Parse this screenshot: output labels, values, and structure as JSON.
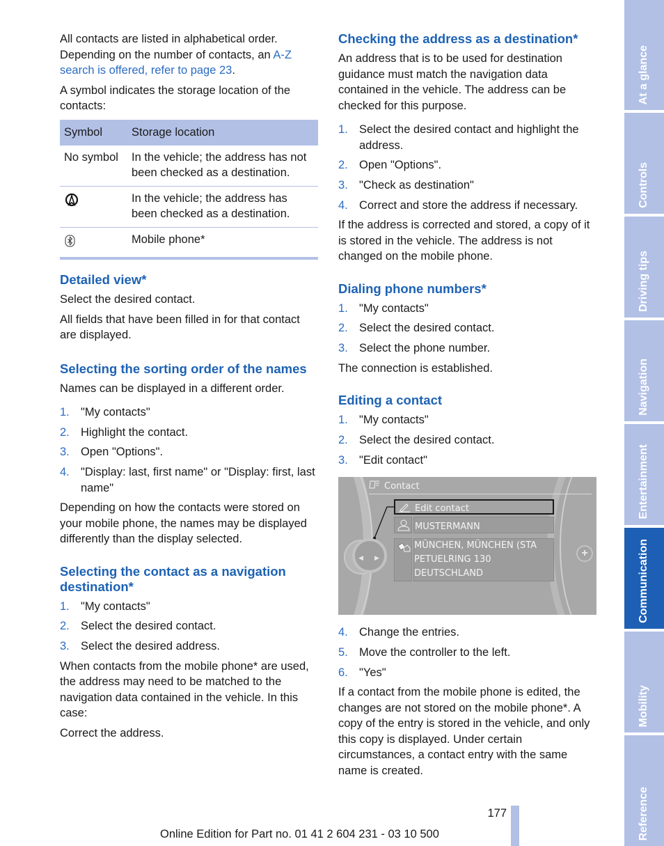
{
  "left": {
    "intro": {
      "text_before_link": "All contacts are listed in alphabetical order. Depending on the number of contacts, an ",
      "link": "A-Z search is offered, refer to page 23",
      "text_after_link": "."
    },
    "symbol_intro": "A symbol indicates the storage location of the contacts:",
    "table": {
      "headers": [
        "Symbol",
        "Storage location"
      ],
      "rows": [
        {
          "symbol": "No symbol",
          "icon": null,
          "location": "In the vehicle; the address has not been checked as a destination."
        },
        {
          "symbol": "",
          "icon": "navigation-checked-icon",
          "location": "In the vehicle; the address has been checked as a destination."
        },
        {
          "symbol": "",
          "icon": "bluetooth-phone-icon",
          "location": "Mobile phone*"
        }
      ]
    },
    "detailed_view": {
      "heading": "Detailed view*",
      "p1": "Select the desired contact.",
      "p2": "All fields that have been filled in for that contact are displayed."
    },
    "sorting": {
      "heading": "Selecting the sorting order of the names",
      "p1": "Names can be displayed in a different order.",
      "steps": [
        {
          "num": "1.",
          "text": "\"My contacts\""
        },
        {
          "num": "2.",
          "text": "Highlight the contact."
        },
        {
          "num": "3.",
          "text": "Open \"Options\"."
        },
        {
          "num": "4.",
          "text": "\"Display: last, first name\" or \"Display: first, last name\""
        }
      ],
      "p2": "Depending on how the contacts were stored on your mobile phone, the names may be displayed differently than the display selected."
    },
    "nav_dest": {
      "heading": "Selecting the contact as a navigation destination*",
      "steps": [
        {
          "num": "1.",
          "text": "\"My contacts\""
        },
        {
          "num": "2.",
          "text": "Select the desired contact."
        },
        {
          "num": "3.",
          "text": "Select the desired address."
        }
      ],
      "p1": "When contacts from the mobile phone* are used, the address may need to be matched to the navigation data contained in the vehicle. In this case:",
      "p2": "Correct the address."
    }
  },
  "right": {
    "checking": {
      "heading": "Checking the address as a destination*",
      "p1": "An address that is to be used for destination guidance must match the navigation data contained in the vehicle. The address can be checked for this purpose.",
      "steps": [
        {
          "num": "1.",
          "text": "Select the desired contact and highlight the address."
        },
        {
          "num": "2.",
          "text": "Open \"Options\"."
        },
        {
          "num": "3.",
          "text": "\"Check as destination\""
        },
        {
          "num": "4.",
          "text": "Correct and store the address if necessary."
        }
      ],
      "p2": "If the address is corrected and stored, a copy of it is stored in the vehicle. The address is not changed on the mobile phone."
    },
    "dialing": {
      "heading": "Dialing phone numbers*",
      "steps": [
        {
          "num": "1.",
          "text": "\"My contacts\""
        },
        {
          "num": "2.",
          "text": "Select the desired contact."
        },
        {
          "num": "3.",
          "text": "Select the phone number."
        }
      ],
      "p1": "The connection is established."
    },
    "editing": {
      "heading": "Editing a contact",
      "steps_a": [
        {
          "num": "1.",
          "text": "\"My contacts\""
        },
        {
          "num": "2.",
          "text": "Select the desired contact."
        },
        {
          "num": "3.",
          "text": "\"Edit contact\""
        }
      ],
      "screen": {
        "title": "Contact",
        "menu_item": "Edit contact",
        "name": "MUSTERMANN",
        "address_lines": [
          "MÜNCHEN, MÜNCHEN (STA",
          "PETUELRING 130",
          "DEUTSCHLAND"
        ]
      },
      "steps_b": [
        {
          "num": "4.",
          "text": "Change the entries."
        },
        {
          "num": "5.",
          "text": "Move the controller to the left."
        },
        {
          "num": "6.",
          "text": "\"Yes\""
        }
      ],
      "p1": "If a contact from the mobile phone is edited, the changes are not stored on the mobile phone*. A copy of the entry is stored in the vehicle, and only this copy is displayed. Under certain circumstances, a contact entry with the same name is created."
    }
  },
  "footer": {
    "page_number": "177",
    "edition": "Online Edition for Part no. 01 41 2 604 231 - 03 10 500"
  },
  "side_tabs": [
    {
      "label": "At a glance",
      "active": false
    },
    {
      "label": "Controls",
      "active": false
    },
    {
      "label": "Driving tips",
      "active": false
    },
    {
      "label": "Navigation",
      "active": false
    },
    {
      "label": "Entertainment",
      "active": false
    },
    {
      "label": "Communication",
      "active": true
    },
    {
      "label": "Mobility",
      "active": false
    },
    {
      "label": "Reference",
      "active": false
    }
  ],
  "colors": {
    "heading_blue": "#1d62b4",
    "link_blue": "#2b6cc4",
    "tab_light": "#b2c0e6",
    "tab_active": "#1d5fb4"
  }
}
